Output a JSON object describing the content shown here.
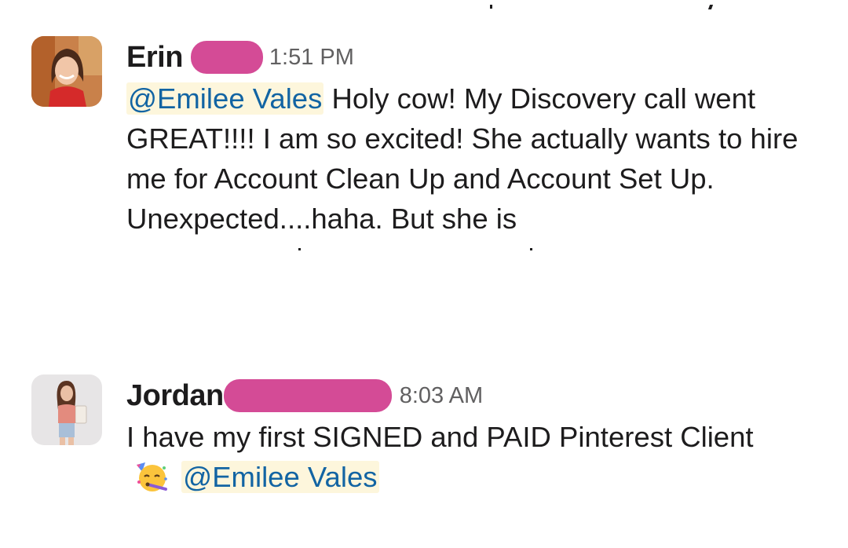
{
  "messages": [
    {
      "author": "Erin",
      "time": "1:51 PM",
      "mention": "@Emilee Vales",
      "text": " Holy cow! My Discovery call went GREAT!!!! I am so excited! She actually wants to hire me for Account Clean Up and Account Set Up. Unexpected....haha. But she is"
    },
    {
      "author": "Jordan",
      "time": "8:03 AM",
      "text": "I have my first SIGNED and PAID Pinterest Client",
      "emoji": "partying-face-icon",
      "mention": "@Emilee Vales"
    }
  ],
  "colors": {
    "mention_bg": "#fdf6dc",
    "mention_text": "#1264a3",
    "redaction": "#d44b96",
    "timestamp": "#616061"
  }
}
